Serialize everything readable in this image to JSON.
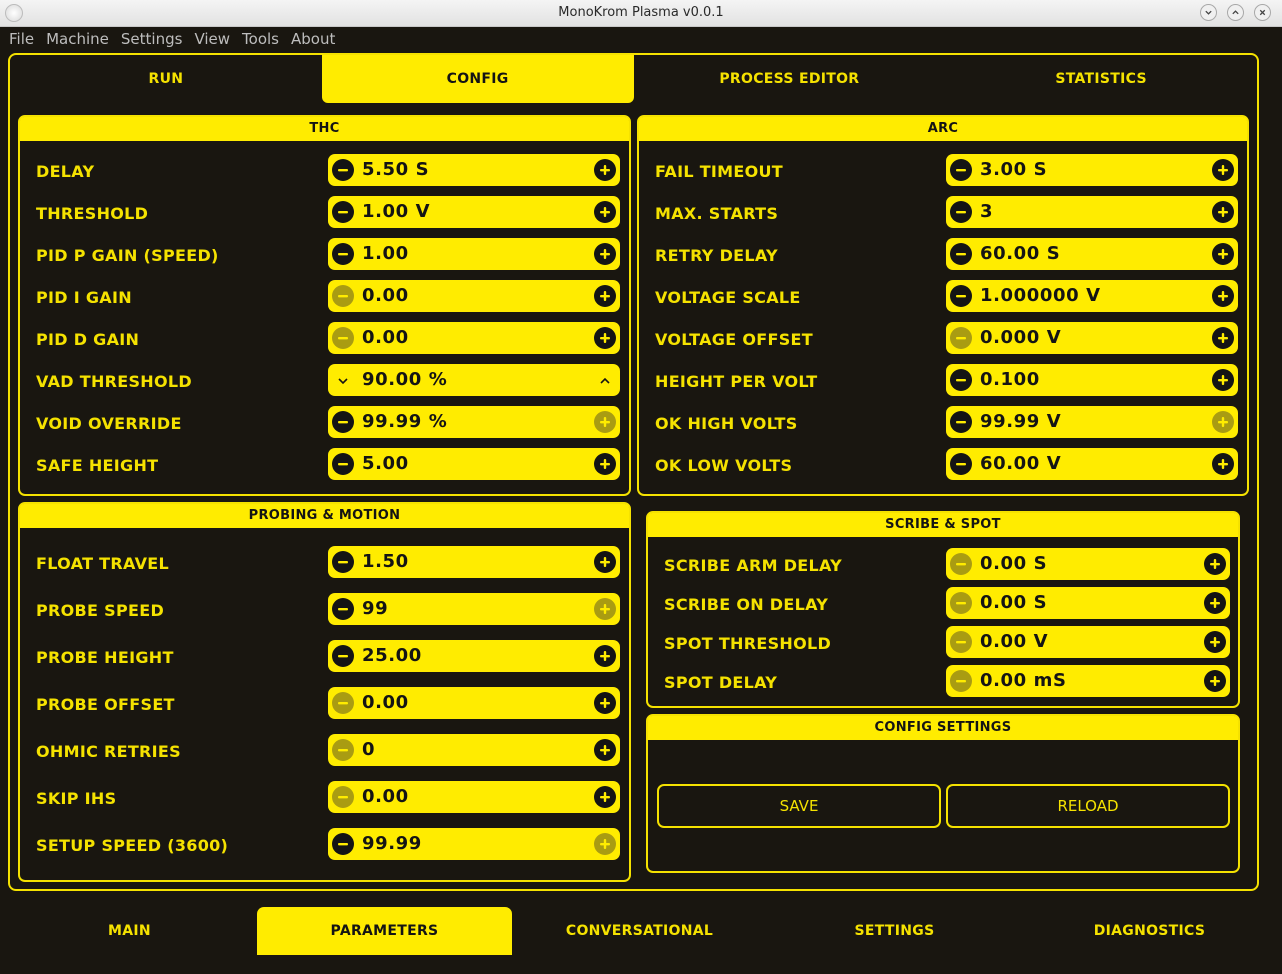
{
  "window": {
    "title": "MonoKrom Plasma v0.0.1"
  },
  "menu": [
    "File",
    "Machine",
    "Settings",
    "View",
    "Tools",
    "About"
  ],
  "top_tabs": [
    "RUN",
    "CONFIG",
    "PROCESS EDITOR",
    "STATISTICS"
  ],
  "top_tab_active": "CONFIG",
  "bottom_tabs": [
    "MAIN",
    "PARAMETERS",
    "CONVERSATIONAL",
    "SETTINGS",
    "DIAGNOSTICS"
  ],
  "bottom_tab_active": "PARAMETERS",
  "thc": {
    "title": "THC",
    "rows": [
      {
        "label": "DELAY",
        "value": "5.50 S",
        "style": "plusminus",
        "minus_enabled": true,
        "plus_enabled": true
      },
      {
        "label": "THRESHOLD",
        "value": "1.00 V",
        "style": "plusminus",
        "minus_enabled": true,
        "plus_enabled": true
      },
      {
        "label": "PID P GAIN (SPEED)",
        "value": "1.00",
        "style": "plusminus",
        "minus_enabled": true,
        "plus_enabled": true
      },
      {
        "label": "PID I GAIN",
        "value": "0.00",
        "style": "plusminus",
        "minus_enabled": false,
        "plus_enabled": true
      },
      {
        "label": "PID D GAIN",
        "value": "0.00",
        "style": "plusminus",
        "minus_enabled": false,
        "plus_enabled": true
      },
      {
        "label": "VAD THRESHOLD",
        "value": "90.00 %",
        "style": "chevron",
        "minus_enabled": true,
        "plus_enabled": true
      },
      {
        "label": "VOID OVERRIDE",
        "value": "99.99 %",
        "style": "plusminus",
        "minus_enabled": true,
        "plus_enabled": false
      },
      {
        "label": "SAFE HEIGHT",
        "value": "5.00",
        "style": "plusminus",
        "minus_enabled": true,
        "plus_enabled": true
      }
    ]
  },
  "arc": {
    "title": "ARC",
    "rows": [
      {
        "label": "FAIL TIMEOUT",
        "value": "3.00 S",
        "style": "plusminus",
        "minus_enabled": true,
        "plus_enabled": true
      },
      {
        "label": "MAX. STARTS",
        "value": "3",
        "style": "plusminus",
        "minus_enabled": true,
        "plus_enabled": true
      },
      {
        "label": "RETRY DELAY",
        "value": "60.00 S",
        "style": "plusminus",
        "minus_enabled": true,
        "plus_enabled": true
      },
      {
        "label": "VOLTAGE SCALE",
        "value": "1.000000 V",
        "style": "plusminus",
        "minus_enabled": true,
        "plus_enabled": true
      },
      {
        "label": "VOLTAGE OFFSET",
        "value": "0.000 V",
        "style": "plusminus",
        "minus_enabled": false,
        "plus_enabled": true
      },
      {
        "label": "HEIGHT PER VOLT",
        "value": "0.100",
        "style": "plusminus",
        "minus_enabled": true,
        "plus_enabled": true
      },
      {
        "label": "OK HIGH VOLTS",
        "value": "99.99 V",
        "style": "plusminus",
        "minus_enabled": true,
        "plus_enabled": false
      },
      {
        "label": "OK LOW VOLTS",
        "value": "60.00 V",
        "style": "plusminus",
        "minus_enabled": true,
        "plus_enabled": true
      }
    ]
  },
  "probing": {
    "title": "PROBING & MOTION",
    "rows": [
      {
        "label": "FLOAT TRAVEL",
        "value": "1.50",
        "style": "plusminus",
        "minus_enabled": true,
        "plus_enabled": true
      },
      {
        "label": "PROBE SPEED",
        "value": "99",
        "style": "plusminus",
        "minus_enabled": true,
        "plus_enabled": false
      },
      {
        "label": "PROBE HEIGHT",
        "value": "25.00",
        "style": "plusminus",
        "minus_enabled": true,
        "plus_enabled": true
      },
      {
        "label": "PROBE OFFSET",
        "value": "0.00",
        "style": "plusminus",
        "minus_enabled": false,
        "plus_enabled": true
      },
      {
        "label": "OHMIC RETRIES",
        "value": "0",
        "style": "plusminus",
        "minus_enabled": false,
        "plus_enabled": true
      },
      {
        "label": "SKIP IHS",
        "value": "0.00",
        "style": "plusminus",
        "minus_enabled": false,
        "plus_enabled": true
      },
      {
        "label": "SETUP SPEED (3600)",
        "value": "99.99",
        "style": "plusminus",
        "minus_enabled": true,
        "plus_enabled": false
      }
    ]
  },
  "scribe": {
    "title": "SCRIBE & SPOT",
    "rows": [
      {
        "label": "SCRIBE ARM DELAY",
        "value": "0.00 S",
        "style": "plusminus",
        "minus_enabled": false,
        "plus_enabled": true
      },
      {
        "label": "SCRIBE ON DELAY",
        "value": "0.00 S",
        "style": "plusminus",
        "minus_enabled": false,
        "plus_enabled": true
      },
      {
        "label": "SPOT THRESHOLD",
        "value": "0.00 V",
        "style": "plusminus",
        "minus_enabled": false,
        "plus_enabled": true
      },
      {
        "label": "SPOT DELAY",
        "value": "0.00 mS",
        "style": "plusminus",
        "minus_enabled": false,
        "plus_enabled": true
      }
    ]
  },
  "config_settings": {
    "title": "CONFIG SETTINGS",
    "save_label": "SAVE",
    "reload_label": "RELOAD"
  },
  "colors": {
    "background": "#191610",
    "accent": "#ffec00",
    "text_dark": "#141414",
    "disabled_button": "#a99c12"
  },
  "icons": {
    "minus": "minus-circle-icon",
    "plus": "plus-circle-icon",
    "chevron_down": "chevron-down-icon",
    "chevron_up": "chevron-up-icon"
  }
}
